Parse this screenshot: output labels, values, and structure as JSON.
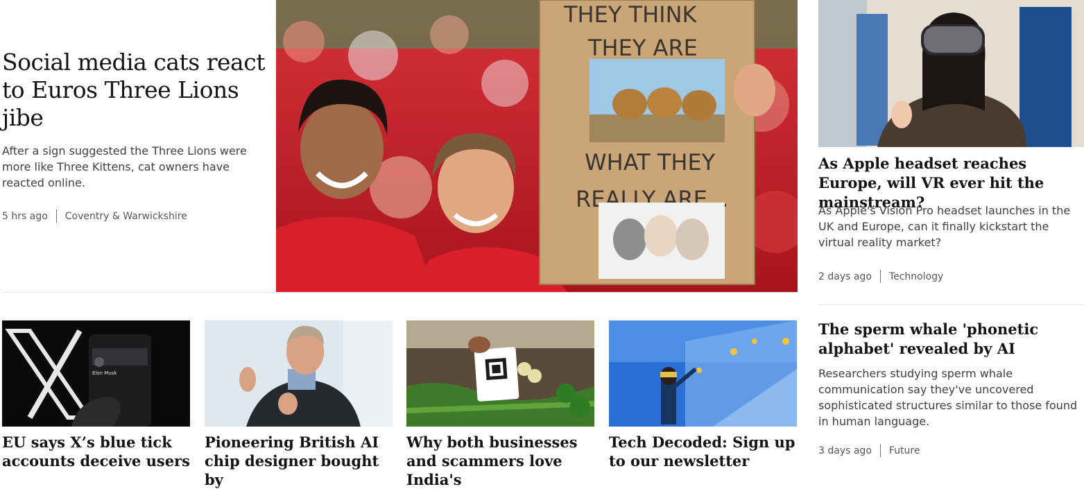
{
  "lead": {
    "title": "Social media cats react to Euros Three Lions jibe",
    "summary": "After a sign suggested the Three Lions were more like Three Kittens, cat owners have reacted online.",
    "time": "5 hrs ago",
    "section": "Coventry & Warwickshire",
    "sign_text_top": [
      "THEY THINK",
      "THEY ARE"
    ],
    "sign_text_bottom": [
      "WHAT THEY",
      "REALLY ARE..."
    ]
  },
  "side_stories": [
    {
      "title": "As Apple headset reaches Europe, will VR ever hit the mainstream?",
      "summary": "As Apple's Vision Pro headset launches in the UK and Europe, can it finally kickstart the virtual reality market?",
      "time": "2 days ago",
      "section": "Technology"
    },
    {
      "title": "The sperm whale 'phonetic alphabet' revealed by AI",
      "summary": "Researchers studying sperm whale communication say they've uncovered sophisticated structures similar to those found in human language.",
      "time": "3 days ago",
      "section": "Future"
    }
  ],
  "cards": [
    {
      "title": "EU says X’s blue tick accounts deceive users",
      "phone_name": "Elon Musk"
    },
    {
      "title": "Pioneering British AI chip designer bought by"
    },
    {
      "title": "Why both businesses and scammers love India's"
    },
    {
      "title": "Tech Decoded: Sign up to our newsletter"
    }
  ],
  "colors": {
    "text": "#141414",
    "summary": "#3f3f42",
    "meta": "#545658",
    "divider": "#e6e8ea"
  }
}
